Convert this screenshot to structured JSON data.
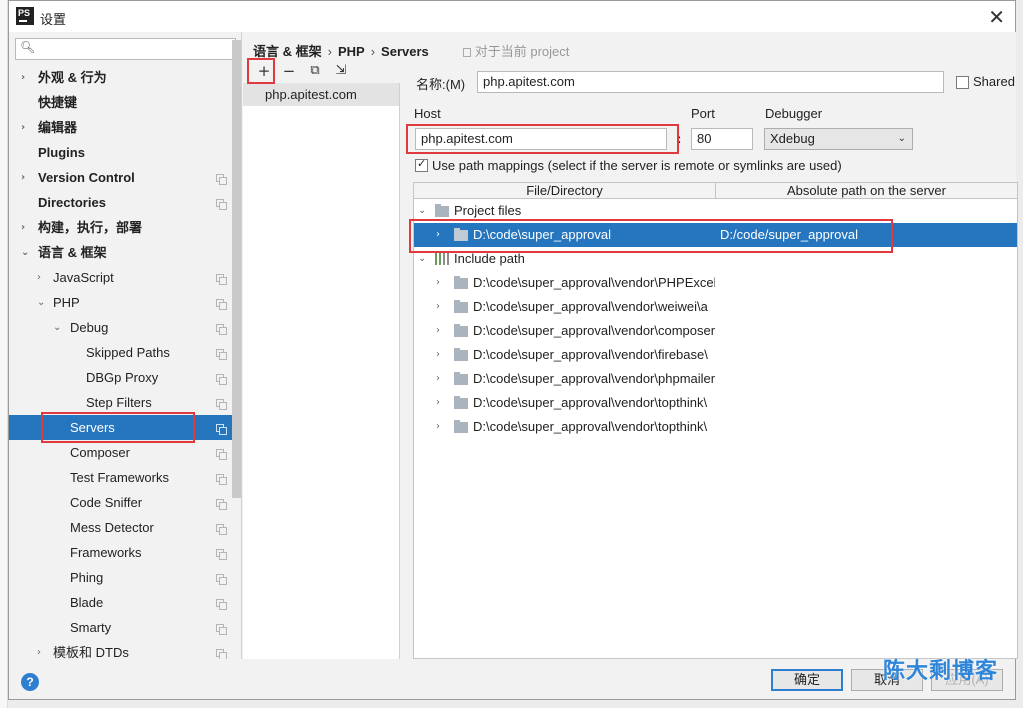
{
  "window": {
    "title": "设置",
    "logo_text": "PS"
  },
  "search": {
    "placeholder": "",
    "value": ""
  },
  "tree": [
    {
      "label": "外观 & 行为",
      "expand": "›",
      "bold": true,
      "copy": false
    },
    {
      "label": "快捷键",
      "bold": true,
      "copy": false
    },
    {
      "label": "编辑器",
      "expand": "›",
      "bold": true,
      "copy": false
    },
    {
      "label": "Plugins",
      "bold": true,
      "copy": false
    },
    {
      "label": "Version Control",
      "expand": "›",
      "bold": true,
      "copy": true
    },
    {
      "label": "Directories",
      "bold": true,
      "copy": true
    },
    {
      "label": "构建，执行，部署",
      "expand": "›",
      "bold": true,
      "copy": false
    },
    {
      "label": "语言 & 框架",
      "expand": "⌄",
      "bold": true,
      "copy": false
    },
    {
      "label": "JavaScript",
      "expand": "›",
      "copy": true
    },
    {
      "label": "PHP",
      "expand": "⌄",
      "copy": true
    },
    {
      "label": "Debug",
      "expand": "⌄",
      "copy": true
    },
    {
      "label": "Skipped Paths",
      "copy": true
    },
    {
      "label": "DBGp Proxy",
      "copy": true
    },
    {
      "label": "Step Filters",
      "copy": true
    },
    {
      "label": "Servers",
      "copy": true,
      "selected": true
    },
    {
      "label": "Composer",
      "copy": true
    },
    {
      "label": "Test Frameworks",
      "copy": true
    },
    {
      "label": "Code Sniffer",
      "copy": true
    },
    {
      "label": "Mess Detector",
      "copy": true
    },
    {
      "label": "Frameworks",
      "copy": true
    },
    {
      "label": "Phing",
      "copy": true
    },
    {
      "label": "Blade",
      "copy": true
    },
    {
      "label": "Smarty",
      "copy": true
    },
    {
      "label": "模板和 DTDs",
      "expand": "›",
      "copy": true
    }
  ],
  "breadcrumb": {
    "part1": "语言 & 框架",
    "part2": "PHP",
    "part3": "Servers",
    "separator": "›",
    "scope": "对于当前 project"
  },
  "toolbar": {
    "add": "+",
    "remove": "−",
    "copy": "⧉",
    "import": "⇲"
  },
  "servers": [
    "php.apitest.com"
  ],
  "form": {
    "name_label": "名称:(M)",
    "name_value": "php.apitest.com",
    "shared_label": "Shared",
    "shared_checked": false,
    "host_label": "Host",
    "host_value": "php.apitest.com",
    "port_label": "Port",
    "port_value": "80",
    "colon": ":",
    "debugger_label": "Debugger",
    "debugger_value": "Xdebug",
    "use_mappings_label": "Use path mappings (select if the server is remote or symlinks are used)",
    "use_mappings_checked": true
  },
  "mappings": {
    "col1": "File/Directory",
    "col2": "Absolute path on the server",
    "rows": [
      {
        "depth": 0,
        "expand": "⌄",
        "icon": "folder",
        "label": "Project files",
        "server_path": ""
      },
      {
        "depth": 1,
        "expand": "›",
        "icon": "folder",
        "label": "D:\\code\\super_approval",
        "server_path": "D:/code/super_approval",
        "selected": true
      },
      {
        "depth": 0,
        "expand": "⌄",
        "icon": "library",
        "label": "Include path",
        "server_path": ""
      },
      {
        "depth": 1,
        "expand": "›",
        "icon": "folder",
        "label": "D:\\code\\super_approval\\vendor\\PHPExcel",
        "server_path": ""
      },
      {
        "depth": 1,
        "expand": "›",
        "icon": "folder",
        "label": "D:\\code\\super_approval\\vendor\\weiwei\\a",
        "server_path": ""
      },
      {
        "depth": 1,
        "expand": "›",
        "icon": "folder",
        "label": "D:\\code\\super_approval\\vendor\\composer",
        "server_path": ""
      },
      {
        "depth": 1,
        "expand": "›",
        "icon": "folder",
        "label": "D:\\code\\super_approval\\vendor\\firebase\\",
        "server_path": ""
      },
      {
        "depth": 1,
        "expand": "›",
        "icon": "folder",
        "label": "D:\\code\\super_approval\\vendor\\phpmailer",
        "server_path": ""
      },
      {
        "depth": 1,
        "expand": "›",
        "icon": "folder",
        "label": "D:\\code\\super_approval\\vendor\\topthink\\",
        "server_path": ""
      },
      {
        "depth": 1,
        "expand": "›",
        "icon": "folder",
        "label": "D:\\code\\super_approval\\vendor\\topthink\\",
        "server_path": ""
      }
    ]
  },
  "buttons": {
    "ok": "确定",
    "cancel": "取消",
    "apply": "应用(A)",
    "help": "?"
  },
  "watermark": "陈大剩博客",
  "colors": {
    "selection": "#2675bf",
    "highlight_box": "#e0393e",
    "accent": "#2f7fd1"
  }
}
